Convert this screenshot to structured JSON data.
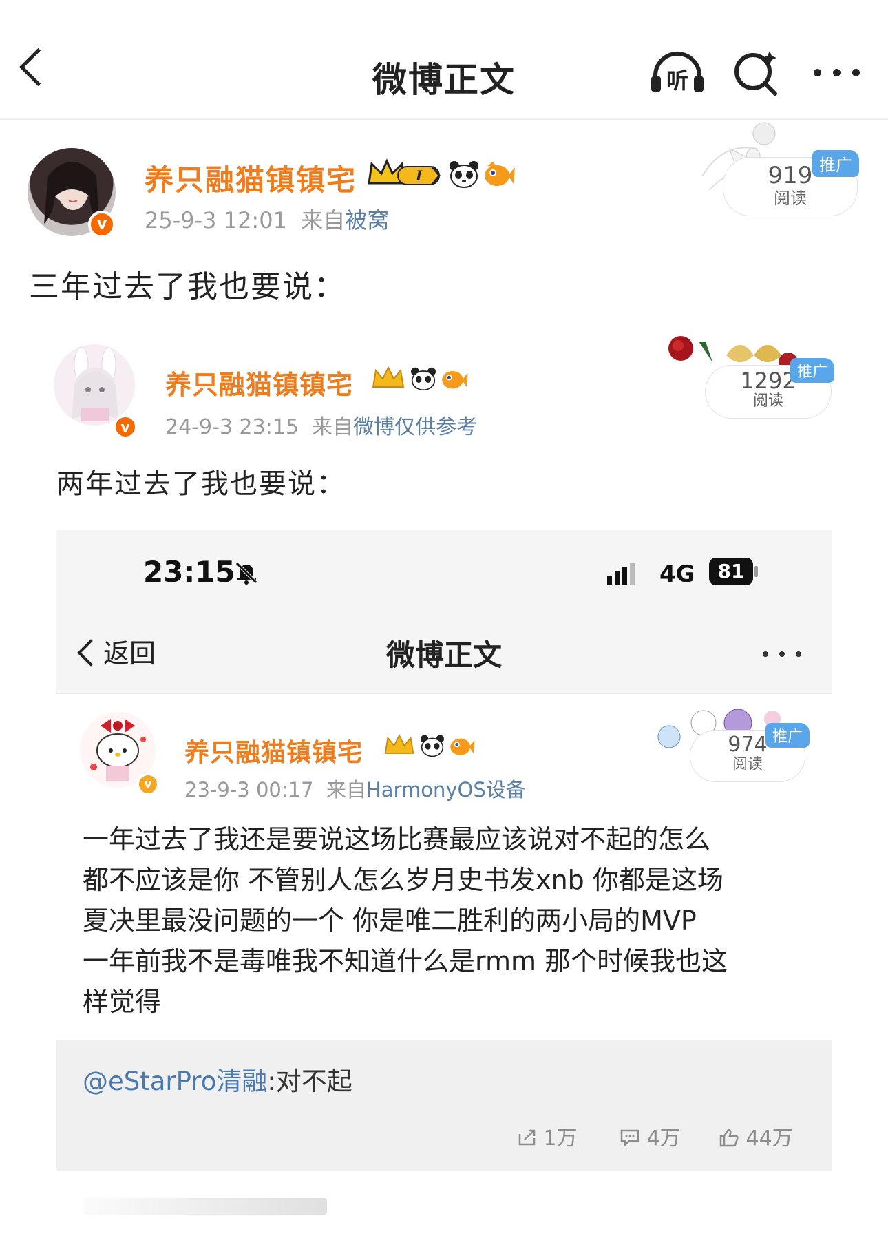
{
  "header": {
    "title": "微博正文",
    "listen_label": "听"
  },
  "post": {
    "username": "养只融猫镇镇宅",
    "timestamp": "25-9-3 12:01",
    "source_prefix": "来自",
    "source": "被窝",
    "read_count": "919",
    "read_label": "阅读",
    "promo_tag": "推广",
    "text": "三年过去了我也要说：",
    "level_badge": "I"
  },
  "quoted": {
    "username": "养只融猫镇镇宅",
    "timestamp": "24-9-3 23:15",
    "source_prefix": "来自",
    "source": "微博仅供参考",
    "read_count": "1292",
    "read_label": "阅读",
    "promo_tag": "推广",
    "text": "两年过去了我也要说："
  },
  "screenshot": {
    "status_time": "23:15",
    "network": "4G",
    "battery": "81",
    "nav_back": "返回",
    "nav_title": "微博正文",
    "inner_post": {
      "username": "养只融猫镇镇宅",
      "timestamp": "23-9-3 00:17",
      "source_prefix": "来自",
      "source": "HarmonyOS设备",
      "read_count": "974",
      "read_label": "阅读",
      "promo_tag": "推广",
      "text_lines": [
        "一年过去了我还是要说这场比赛最应该说对不起的怎么",
        "都不应该是你 不管别人怎么岁月史书发xnb 你都是这场",
        "夏决里最没问题的一个 你是唯二胜利的两小局的MVP",
        "一年前我不是毒唯我不知道什么是rmm 那个时候我也这",
        "样觉得"
      ]
    },
    "repost": {
      "mention": "@eStarPro清融",
      "text": ":对不起"
    },
    "actions": {
      "reposts": "1万",
      "comments": "4万",
      "likes": "44万"
    }
  }
}
